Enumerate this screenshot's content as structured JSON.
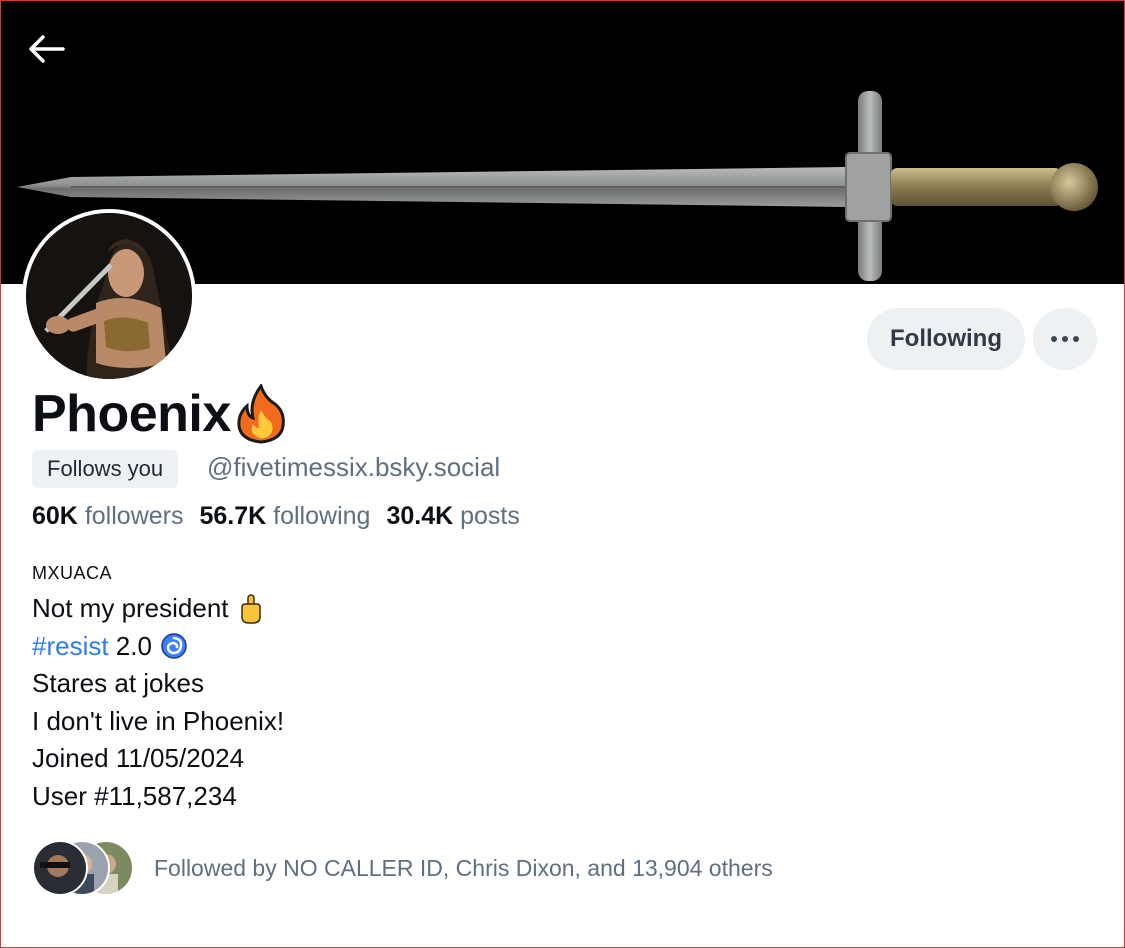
{
  "header": {
    "back_icon": "arrow-left-icon"
  },
  "profile": {
    "display_name": "Phoenix",
    "name_emoji": "fire-icon",
    "follows_you_label": "Follows you",
    "handle": "@fivetimessix.bsky.social",
    "following_button_label": "Following",
    "more_icon": "ellipsis-icon"
  },
  "stats": {
    "followers_count": "60K",
    "followers_label": "followers",
    "following_count": "56.7K",
    "following_label": "following",
    "posts_count": "30.4K",
    "posts_label": "posts"
  },
  "bio": {
    "tag": "MXUACA",
    "line1": "Not my president",
    "line1_emoji": "middle-finger-icon",
    "hashtag": "#resist",
    "line2_rest": " 2.0",
    "line2_emoji": "cyclone-icon",
    "line3": "Stares at jokes",
    "line4": "I don't live in Phoenix!",
    "line5": "Joined 11/05/2024",
    "line6": "User #11,587,234"
  },
  "followed_by": {
    "text": "Followed by NO CALLER ID, Chris Dixon, and 13,904 others"
  },
  "colors": {
    "link": "#2f7bf0",
    "muted": "#5f6f80",
    "button_bg": "#eef1f4",
    "banner_bg": "#000000"
  }
}
